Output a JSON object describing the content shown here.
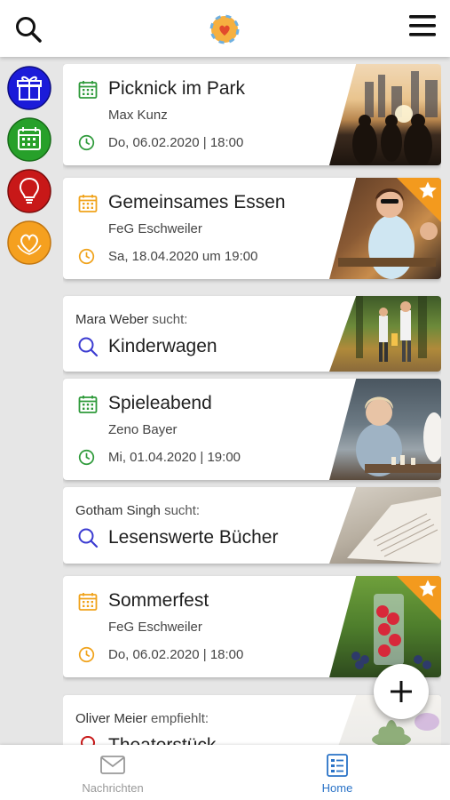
{
  "header": {
    "search_icon": "search-icon",
    "logo_icon": "heart-hands-logo",
    "menu_icon": "hamburger-menu-icon"
  },
  "categories": [
    {
      "name": "gift",
      "color": "#1b1bd9"
    },
    {
      "name": "calendar",
      "color": "#27a02a"
    },
    {
      "name": "idea",
      "color": "#c81818"
    },
    {
      "name": "heart",
      "color": "#f5a01f"
    }
  ],
  "colors": {
    "event_green": "#2e9a3a",
    "event_orange": "#f0a21a",
    "search_blue": "#3b3bd1",
    "nav_active": "#2a73c7"
  },
  "cards": [
    {
      "type": "event",
      "title": "Picknick im Park",
      "org": "Max Kunz",
      "date": "Do, 06.02.2020 | 18:00",
      "accent": "green",
      "starred": false,
      "image": "park-sunset"
    },
    {
      "type": "event",
      "title": "Gemeinsames Essen",
      "org": "FeG Eschweiler",
      "date": "Sa, 18.04.2020 um 19:00",
      "accent": "orange",
      "starred": true,
      "image": "people-eating"
    },
    {
      "type": "search",
      "person": "Mara Weber",
      "verb": "sucht:",
      "title": "Kinderwagen",
      "image": "family-walk"
    },
    {
      "type": "event",
      "title": "Spieleabend",
      "org": "Zeno Bayer",
      "date": "Mi, 01.04.2020 | 19:00",
      "accent": "green",
      "starred": false,
      "image": "chess-game"
    },
    {
      "type": "search",
      "person": "Gotham Singh",
      "verb": "sucht:",
      "title": "Lesenswerte Bücher",
      "image": "open-book"
    },
    {
      "type": "event",
      "title": "Sommerfest",
      "org": "FeG Eschweiler",
      "date": "Do, 06.02.2020 | 18:00",
      "accent": "orange",
      "starred": true,
      "image": "raspberries"
    },
    {
      "type": "recommend",
      "person": "Oliver Meier",
      "verb": "empfiehlt:",
      "title": "Theaterstück",
      "image": "succulent"
    }
  ],
  "fab": {
    "icon": "plus-icon"
  },
  "bottom_nav": [
    {
      "label": "Nachrichten",
      "icon": "envelope-icon",
      "active": false
    },
    {
      "label": "Home",
      "icon": "list-icon",
      "active": true
    }
  ]
}
